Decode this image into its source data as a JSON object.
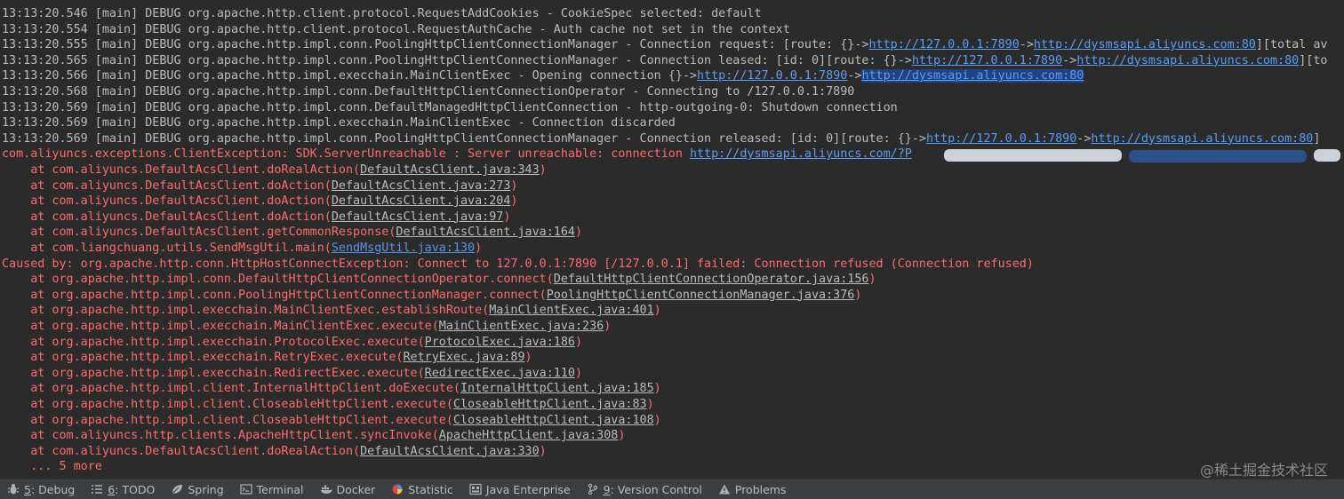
{
  "console": {
    "lines": [
      {
        "kind": "info",
        "segments": [
          {
            "t": "13:13:20.546 [main] DEBUG org.apache.http.client.protocol.RequestAddCookies - CookieSpec selected: default"
          }
        ]
      },
      {
        "kind": "info",
        "segments": [
          {
            "t": "13:13:20.554 [main] DEBUG org.apache.http.client.protocol.RequestAuthCache - Auth cache not set in the context"
          }
        ]
      },
      {
        "kind": "info",
        "segments": [
          {
            "t": "13:13:20.555 [main] DEBUG org.apache.http.impl.conn.PoolingHttpClientConnectionManager - Connection request: [route: {}->"
          },
          {
            "t": "http://127.0.0.1:7890",
            "c": "link"
          },
          {
            "t": "->"
          },
          {
            "t": "http://dysmsapi.aliyuncs.com:80",
            "c": "link"
          },
          {
            "t": "][total av"
          }
        ]
      },
      {
        "kind": "info",
        "segments": [
          {
            "t": "13:13:20.565 [main] DEBUG org.apache.http.impl.conn.PoolingHttpClientConnectionManager - Connection leased: [id: 0][route: {}->"
          },
          {
            "t": "http://127.0.0.1:7890",
            "c": "link"
          },
          {
            "t": "->"
          },
          {
            "t": "http://dysmsapi.aliyuncs.com:80",
            "c": "link"
          },
          {
            "t": "][to"
          }
        ]
      },
      {
        "kind": "info",
        "segments": [
          {
            "t": "13:13:20.566 [main] DEBUG org.apache.http.impl.execchain.MainClientExec - Opening connection {}->"
          },
          {
            "t": "http://127.0.0.1:7890",
            "c": "link"
          },
          {
            "t": "->"
          },
          {
            "t": "http://dysmsapi.aliyuncs.com:80",
            "c": "link sel"
          }
        ]
      },
      {
        "kind": "info",
        "segments": [
          {
            "t": "13:13:20.568 [main] DEBUG org.apache.http.impl.conn.DefaultHttpClientConnectionOperator - Connecting to /127.0.0.1:7890"
          }
        ]
      },
      {
        "kind": "info",
        "segments": [
          {
            "t": "13:13:20.569 [main] DEBUG org.apache.http.impl.conn.DefaultManagedHttpClientConnection - http-outgoing-0: Shutdown connection"
          }
        ]
      },
      {
        "kind": "info",
        "segments": [
          {
            "t": "13:13:20.569 [main] DEBUG org.apache.http.impl.execchain.MainClientExec - Connection discarded"
          }
        ]
      },
      {
        "kind": "info",
        "segments": [
          {
            "t": "13:13:20.569 [main] DEBUG org.apache.http.impl.conn.PoolingHttpClientConnectionManager - Connection released: [id: 0][route: {}->"
          },
          {
            "t": "http://127.0.0.1:7890",
            "c": "link"
          },
          {
            "t": "->"
          },
          {
            "t": "http://dysmsapi.aliyuncs.com:80",
            "c": "link"
          },
          {
            "t": "]"
          }
        ]
      },
      {
        "kind": "err",
        "segments": [
          {
            "t": "com.aliyuncs.exceptions.ClientException: SDK.ServerUnreachable : Server unreachable: connection "
          },
          {
            "t": "http://dysmsapi.aliyuncs.com/?P",
            "c": "link"
          }
        ]
      },
      {
        "kind": "err",
        "segments": [
          {
            "t": "    at com.aliyuncs.DefaultAcsClient.doRealAction("
          },
          {
            "t": "DefaultAcsClient.java:343",
            "c": "src"
          },
          {
            "t": ")"
          }
        ]
      },
      {
        "kind": "err",
        "segments": [
          {
            "t": "    at com.aliyuncs.DefaultAcsClient.doAction("
          },
          {
            "t": "DefaultAcsClient.java:273",
            "c": "src"
          },
          {
            "t": ")"
          }
        ]
      },
      {
        "kind": "err",
        "segments": [
          {
            "t": "    at com.aliyuncs.DefaultAcsClient.doAction("
          },
          {
            "t": "DefaultAcsClient.java:204",
            "c": "src"
          },
          {
            "t": ")"
          }
        ]
      },
      {
        "kind": "err",
        "segments": [
          {
            "t": "    at com.aliyuncs.DefaultAcsClient.doAction("
          },
          {
            "t": "DefaultAcsClient.java:97",
            "c": "src"
          },
          {
            "t": ")"
          }
        ]
      },
      {
        "kind": "err",
        "segments": [
          {
            "t": "    at com.aliyuncs.DefaultAcsClient.getCommonResponse("
          },
          {
            "t": "DefaultAcsClient.java:164",
            "c": "src"
          },
          {
            "t": ")"
          }
        ]
      },
      {
        "kind": "err",
        "segments": [
          {
            "t": "    at com.liangchuang.utils.SendMsgUtil.main("
          },
          {
            "t": "SendMsgUtil.java:130",
            "c": "src hl"
          },
          {
            "t": ")"
          }
        ]
      },
      {
        "kind": "err",
        "segments": [
          {
            "t": "Caused by: org.apache.http.conn.HttpHostConnectException: Connect to 127.0.0.1:7890 [/127.0.0.1] failed: Connection refused (Connection refused)"
          }
        ]
      },
      {
        "kind": "err",
        "segments": [
          {
            "t": "    at org.apache.http.impl.conn.DefaultHttpClientConnectionOperator.connect("
          },
          {
            "t": "DefaultHttpClientConnectionOperator.java:156",
            "c": "src"
          },
          {
            "t": ")"
          }
        ]
      },
      {
        "kind": "err",
        "segments": [
          {
            "t": "    at org.apache.http.impl.conn.PoolingHttpClientConnectionManager.connect("
          },
          {
            "t": "PoolingHttpClientConnectionManager.java:376",
            "c": "src"
          },
          {
            "t": ")"
          }
        ]
      },
      {
        "kind": "err",
        "segments": [
          {
            "t": "    at org.apache.http.impl.execchain.MainClientExec.establishRoute("
          },
          {
            "t": "MainClientExec.java:401",
            "c": "src"
          },
          {
            "t": ")"
          }
        ]
      },
      {
        "kind": "err",
        "segments": [
          {
            "t": "    at org.apache.http.impl.execchain.MainClientExec.execute("
          },
          {
            "t": "MainClientExec.java:236",
            "c": "src"
          },
          {
            "t": ")"
          }
        ]
      },
      {
        "kind": "err",
        "segments": [
          {
            "t": "    at org.apache.http.impl.execchain.ProtocolExec.execute("
          },
          {
            "t": "ProtocolExec.java:186",
            "c": "src"
          },
          {
            "t": ")"
          }
        ]
      },
      {
        "kind": "err",
        "segments": [
          {
            "t": "    at org.apache.http.impl.execchain.RetryExec.execute("
          },
          {
            "t": "RetryExec.java:89",
            "c": "src"
          },
          {
            "t": ")"
          }
        ]
      },
      {
        "kind": "err",
        "segments": [
          {
            "t": "    at org.apache.http.impl.execchain.RedirectExec.execute("
          },
          {
            "t": "RedirectExec.java:110",
            "c": "src"
          },
          {
            "t": ")"
          }
        ]
      },
      {
        "kind": "err",
        "segments": [
          {
            "t": "    at org.apache.http.impl.client.InternalHttpClient.doExecute("
          },
          {
            "t": "InternalHttpClient.java:185",
            "c": "src"
          },
          {
            "t": ")"
          }
        ]
      },
      {
        "kind": "err",
        "segments": [
          {
            "t": "    at org.apache.http.impl.client.CloseableHttpClient.execute("
          },
          {
            "t": "CloseableHttpClient.java:83",
            "c": "src"
          },
          {
            "t": ")"
          }
        ]
      },
      {
        "kind": "err",
        "segments": [
          {
            "t": "    at org.apache.http.impl.client.CloseableHttpClient.execute("
          },
          {
            "t": "CloseableHttpClient.java:108",
            "c": "src"
          },
          {
            "t": ")"
          }
        ]
      },
      {
        "kind": "err",
        "segments": [
          {
            "t": "    at com.aliyuncs.http.clients.ApacheHttpClient.syncInvoke("
          },
          {
            "t": "ApacheHttpClient.java:308",
            "c": "src"
          },
          {
            "t": ")"
          }
        ]
      },
      {
        "kind": "err",
        "segments": [
          {
            "t": "    at com.aliyuncs.DefaultAcsClient.doRealAction("
          },
          {
            "t": "DefaultAcsClient.java:330",
            "c": "src"
          },
          {
            "t": ")"
          }
        ]
      },
      {
        "kind": "err",
        "segments": [
          {
            "t": "    ... 5 more"
          }
        ]
      }
    ]
  },
  "watermark": "@稀土掘金技术社区",
  "toolwindows": [
    {
      "id": "debug",
      "num": "5",
      "label": ": Debug",
      "icon": "bug-icon"
    },
    {
      "id": "todo",
      "num": "6",
      "label": ": TODO",
      "icon": "list-icon"
    },
    {
      "id": "spring",
      "num": "",
      "label": "Spring",
      "icon": "leaf-icon"
    },
    {
      "id": "terminal",
      "num": "",
      "label": "Terminal",
      "icon": "terminal-icon"
    },
    {
      "id": "docker",
      "num": "",
      "label": "Docker",
      "icon": "docker-icon"
    },
    {
      "id": "statistic",
      "num": "",
      "label": "Statistic",
      "icon": "pie-chart-icon"
    },
    {
      "id": "java-enterprise",
      "num": "",
      "label": "Java Enterprise",
      "icon": "java-enterprise-icon"
    },
    {
      "id": "version-control",
      "num": "9",
      "label": ": Version Control",
      "icon": "branch-icon"
    },
    {
      "id": "problems",
      "num": "",
      "label": "Problems",
      "icon": "warning-icon"
    }
  ],
  "colors": {
    "background": "#2b2b2b",
    "text": "#bbbbbb",
    "error": "#ff6b68",
    "link": "#589df6",
    "toolbar": "#3c3f41"
  }
}
